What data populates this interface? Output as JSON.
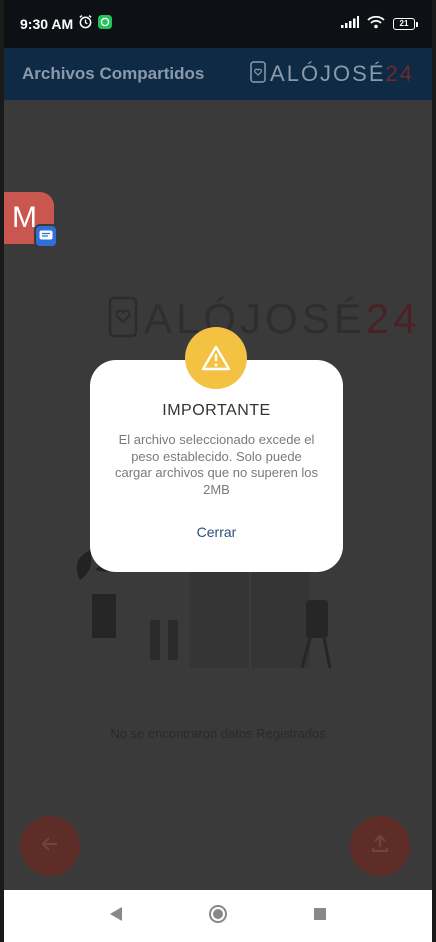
{
  "status_bar": {
    "time": "9:30 AM",
    "battery": "21"
  },
  "app_bar": {
    "title": "Archivos Compartidos",
    "logo_text": "ALÓJOSÉ",
    "logo_num": "24"
  },
  "content": {
    "logo_text": "ALÓJOSÉ",
    "logo_num": "24",
    "empty_message": "No se encontraron datos Registrados"
  },
  "chat_head": {
    "letter": "M"
  },
  "dialog": {
    "title": "IMPORTANTE",
    "message": "El archivo seleccionado excede el peso establecido. Solo puede cargar archivos que no superen los 2MB",
    "close_label": "Cerrar"
  },
  "colors": {
    "warning": "#f4c242",
    "app_bar": "#0f2a44",
    "fab": "#5e2d28"
  }
}
